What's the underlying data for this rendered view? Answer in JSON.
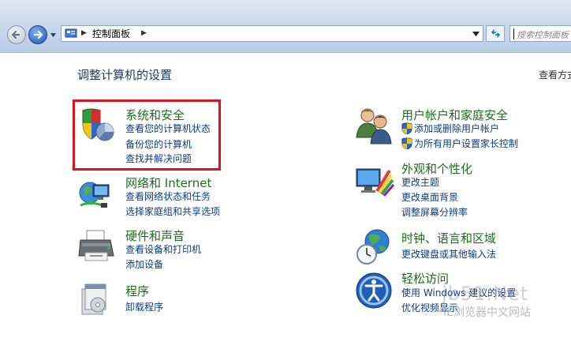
{
  "address_bar": {
    "breadcrumb": "控制面板"
  },
  "search": {
    "placeholder": "搜索控制面板"
  },
  "main": {
    "heading": "调整计算机的设置",
    "view_by": "查看方式"
  },
  "categories": [
    {
      "title": "系统和安全",
      "icon": "system-security-icon",
      "links": [
        "查看您的计算机状态",
        "备份您的计算机",
        "查找并解决问题"
      ]
    },
    {
      "title": "网络和 Internet",
      "icon": "network-icon",
      "links": [
        "查看网络状态和任务",
        "选择家庭组和共享选项"
      ]
    },
    {
      "title": "硬件和声音",
      "icon": "printer-icon",
      "links": [
        "查看设备和打印机",
        "添加设备"
      ]
    },
    {
      "title": "程序",
      "icon": "programs-icon",
      "links": [
        "卸载程序"
      ]
    },
    {
      "title": "用户帐户和家庭安全",
      "icon": "users-icon",
      "links": [
        "添加或删除用户帐户",
        "为所有用户设置家长控制"
      ]
    },
    {
      "title": "外观和个性化",
      "icon": "appearance-icon",
      "links": [
        "更改主题",
        "更改桌面背景",
        "调整屏幕分辨率"
      ]
    },
    {
      "title": "时钟、语言和区域",
      "icon": "clock-globe-icon",
      "links": [
        "更改键盘或其他输入法"
      ]
    },
    {
      "title": "轻松访问",
      "icon": "ease-of-access-icon",
      "links": [
        "使用 Windows 建议的设置",
        "优化视频显示"
      ]
    }
  ],
  "watermark": {
    "text": "jb51.Net",
    "subtext": "IE浏览器中文网站"
  },
  "colors": {
    "category_title": "#1e6b1e",
    "link": "#0c3d87",
    "highlight_border": "#d7141b"
  }
}
